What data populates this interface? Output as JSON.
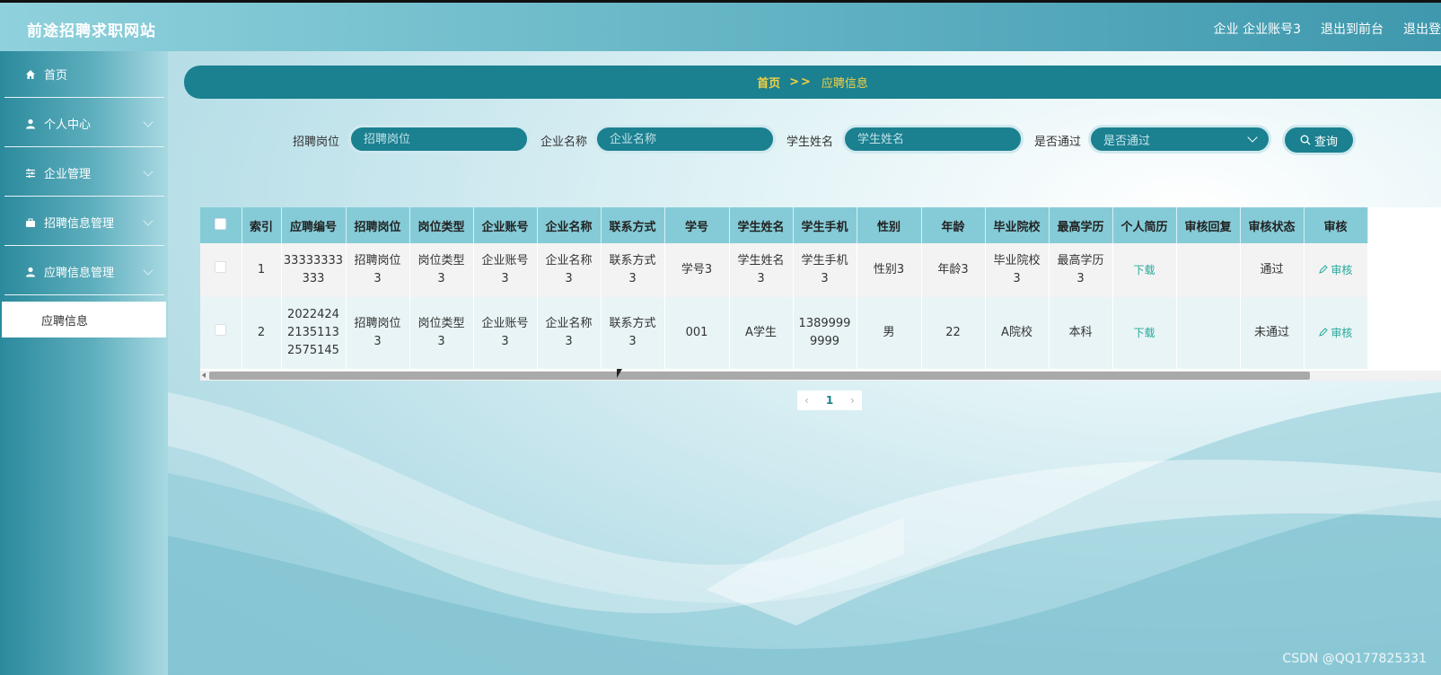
{
  "header": {
    "site_title": "前途招聘求职网站",
    "user": "企业 企业账号3",
    "back_front": "退出到前台",
    "logout": "退出登"
  },
  "sidebar": {
    "items": [
      {
        "label": "首页",
        "icon": "home-icon"
      },
      {
        "label": "个人中心",
        "icon": "user-icon"
      },
      {
        "label": "企业管理",
        "icon": "sliders-icon"
      },
      {
        "label": "招聘信息管理",
        "icon": "briefcase-icon"
      },
      {
        "label": "应聘信息管理",
        "icon": "user-icon"
      }
    ],
    "active_sub": "应聘信息"
  },
  "breadcrumb": {
    "home": "首页",
    "sep": ">>",
    "current": "应聘信息"
  },
  "search": {
    "job_label": "招聘岗位",
    "job_placeholder": "招聘岗位",
    "company_label": "企业名称",
    "company_placeholder": "企业名称",
    "student_label": "学生姓名",
    "student_placeholder": "学生姓名",
    "pass_label": "是否通过",
    "pass_value": "是否通过",
    "query_label": "查询"
  },
  "table": {
    "headers": [
      "索引",
      "应聘编号",
      "招聘岗位",
      "岗位类型",
      "企业账号",
      "企业名称",
      "联系方式",
      "学号",
      "学生姓名",
      "学生手机",
      "性别",
      "年龄",
      "毕业院校",
      "最高学历",
      "个人简历",
      "审核回复",
      "审核状态",
      "审核"
    ],
    "rows": [
      {
        "index": "1",
        "code": [
          "33333333",
          "333"
        ],
        "job": [
          "招聘岗位",
          "3"
        ],
        "type": [
          "岗位类型",
          "3"
        ],
        "account": [
          "企业账号",
          "3"
        ],
        "company": [
          "企业名称",
          "3"
        ],
        "contact": [
          "联系方式",
          "3"
        ],
        "student_no": "学号3",
        "student_name": [
          "学生姓名",
          "3"
        ],
        "phone": [
          "学生手机",
          "3"
        ],
        "gender": "性别3",
        "age": "年龄3",
        "school": [
          "毕业院校",
          "3"
        ],
        "edu": [
          "最高学历",
          "3"
        ],
        "resume": "下载",
        "reply": "",
        "status": "通过",
        "audit": "审核"
      },
      {
        "index": "2",
        "code": [
          "2022424",
          "2135113",
          "2575145"
        ],
        "job": [
          "招聘岗位",
          "3"
        ],
        "type": [
          "岗位类型",
          "3"
        ],
        "account": [
          "企业账号",
          "3"
        ],
        "company": [
          "企业名称",
          "3"
        ],
        "contact": [
          "联系方式",
          "3"
        ],
        "student_no": "001",
        "student_name": [
          "A学生"
        ],
        "phone": [
          "1389999",
          "9999"
        ],
        "gender": "男",
        "age": "22",
        "school": [
          "A院校"
        ],
        "edu": [
          "本科"
        ],
        "resume": "下载",
        "reply": "",
        "status": "未通过",
        "audit": "审核"
      }
    ]
  },
  "pagination": {
    "prev": "‹",
    "page": "1",
    "next": "›"
  },
  "watermark": "CSDN @QQ177825331",
  "colors": {
    "primary": "#1b8090",
    "accent": "#f5d142",
    "link": "#25a89a"
  }
}
